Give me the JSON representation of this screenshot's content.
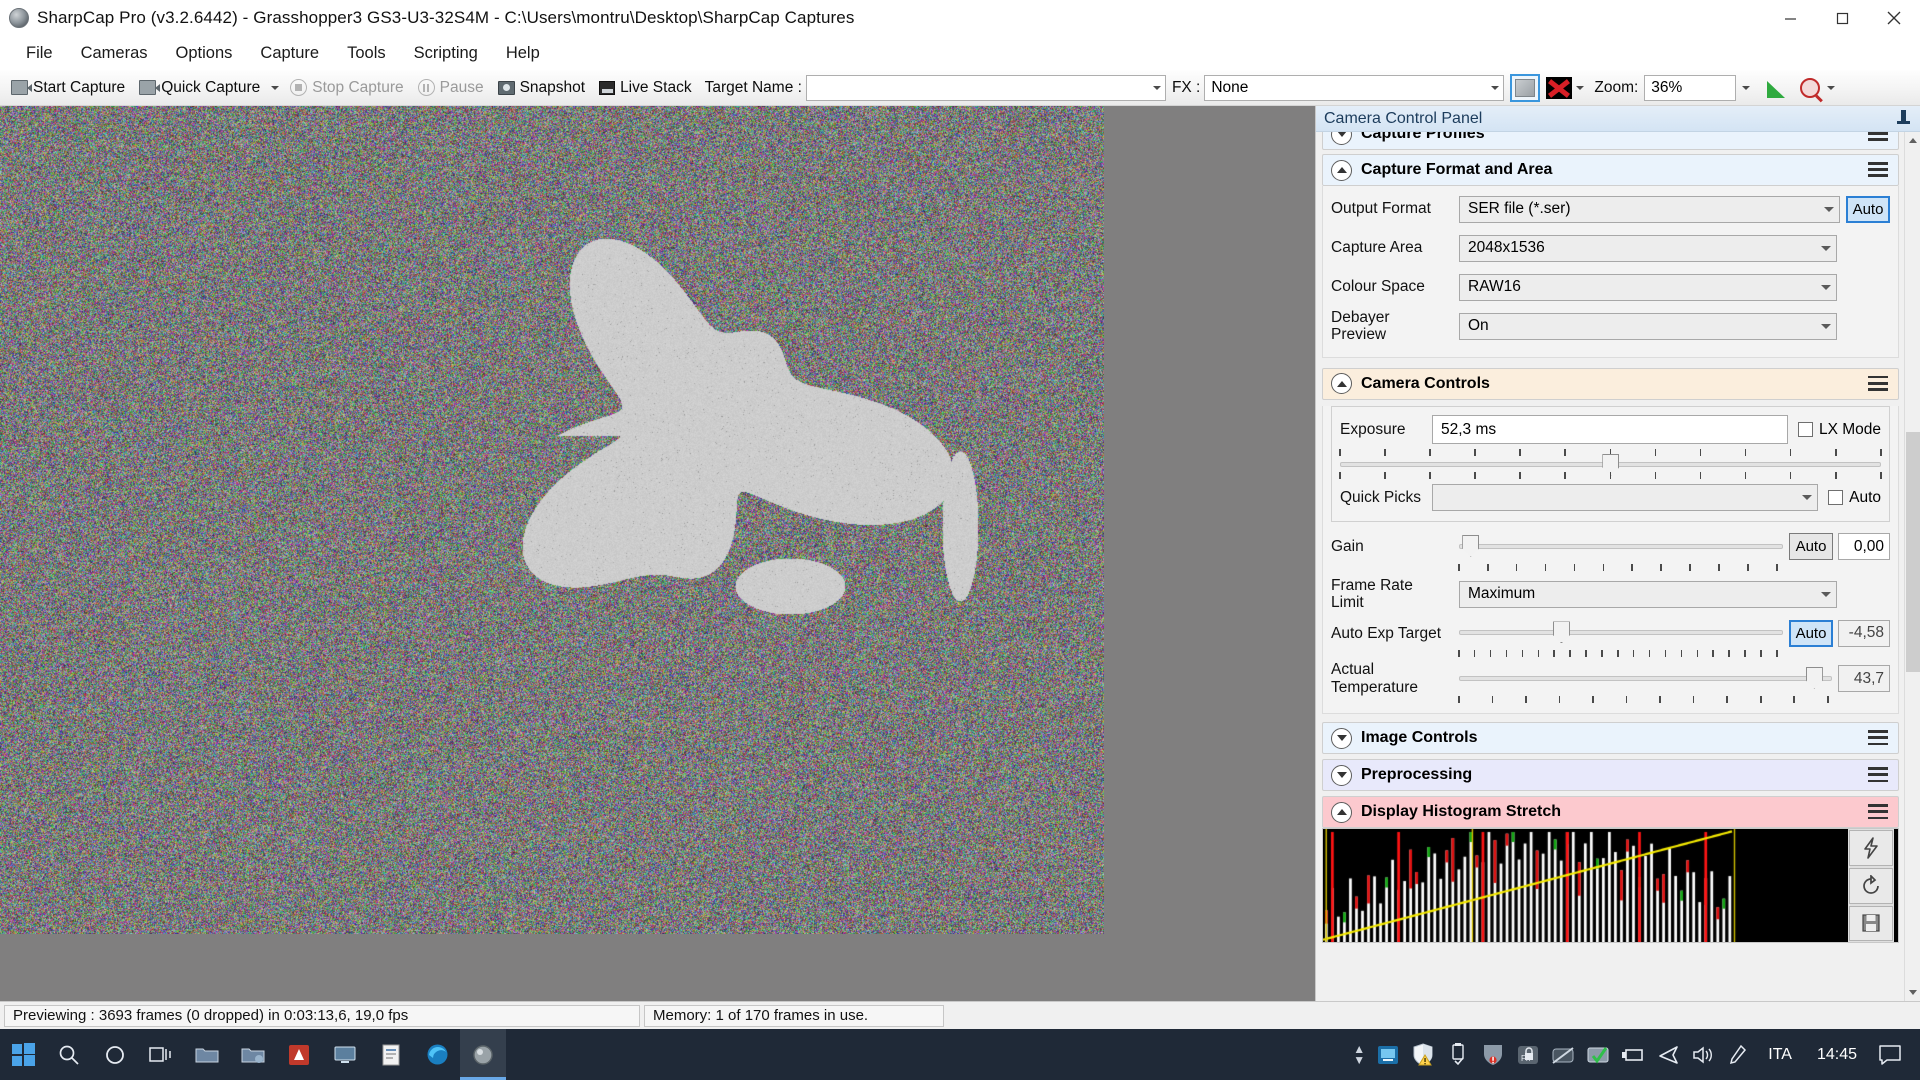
{
  "window": {
    "title": "SharpCap Pro (v3.2.6442) - Grasshopper3 GS3-U3-32S4M - C:\\Users\\montru\\Desktop\\SharpCap Captures",
    "icon": "sharpcap-logo-icon",
    "minimize": "minimize-icon",
    "maximize": "maximize-icon",
    "close": "close-icon"
  },
  "menubar": {
    "items": [
      {
        "label": "File"
      },
      {
        "label": "Cameras"
      },
      {
        "label": "Options"
      },
      {
        "label": "Capture"
      },
      {
        "label": "Tools"
      },
      {
        "label": "Scripting"
      },
      {
        "label": "Help"
      }
    ]
  },
  "toolbar": {
    "start_capture": "Start Capture",
    "quick_capture": "Quick Capture",
    "stop_capture": "Stop Capture",
    "pause": "Pause",
    "snapshot": "Snapshot",
    "live_stack": "Live Stack",
    "target_name_label": "Target Name :",
    "target_name_value": "",
    "fx_label": "FX :",
    "fx_value": "None",
    "zoom_label": "Zoom:",
    "zoom_value": "36%"
  },
  "panel": {
    "title": "Camera Control Panel",
    "groups": {
      "capture_profiles": {
        "label": "Capture Profiles",
        "expanded": false
      },
      "capture_format": {
        "label": "Capture Format and Area",
        "expanded": true,
        "rows": [
          {
            "label": "Output Format",
            "value": "SER file (*.ser)",
            "auto": "Auto"
          },
          {
            "label": "Capture Area",
            "value": "2048x1536"
          },
          {
            "label": "Colour Space",
            "value": "RAW16"
          },
          {
            "label": "Debayer Preview",
            "value": "On"
          }
        ]
      },
      "camera_controls": {
        "label": "Camera Controls",
        "expanded": true,
        "exposure": {
          "label": "Exposure",
          "value": "52,3 ms",
          "lx_mode_label": "LX Mode",
          "lx_mode_checked": false
        },
        "quick_picks": {
          "label": "Quick Picks",
          "value": "",
          "auto_label": "Auto",
          "auto_checked": false
        },
        "gain": {
          "label": "Gain",
          "value": "0,00",
          "auto_label": "Auto",
          "auto_active": false,
          "thumb_pct": 2
        },
        "frame_rate_limit": {
          "label": "Frame Rate Limit",
          "value": "Maximum"
        },
        "auto_exp_target": {
          "label": "Auto Exp Target",
          "value": "-4,58",
          "auto_label": "Auto",
          "auto_active": true,
          "thumb_pct": 30
        },
        "actual_temperature": {
          "label": "Actual Temperature",
          "value": "43,7",
          "thumb_pct": 94
        }
      },
      "image_controls": {
        "label": "Image Controls",
        "expanded": false
      },
      "preprocessing": {
        "label": "Preprocessing",
        "expanded": false
      },
      "display_histogram_stretch": {
        "label": "Display Histogram Stretch",
        "expanded": true,
        "buttons": [
          "lightning-icon",
          "reset-icon",
          "save-icon"
        ]
      }
    }
  },
  "statusbar": {
    "preview_text": "Previewing : 3693 frames (0 dropped) in 0:03:13,6, 19,0 fps",
    "memory_text": "Memory: 1 of 170 frames in use."
  },
  "taskbar": {
    "items": [
      {
        "name": "start-button",
        "icon": "windows-logo-icon"
      },
      {
        "name": "search-button",
        "icon": "search-icon"
      },
      {
        "name": "cortana-button",
        "icon": "circle-icon"
      },
      {
        "name": "task-view-button",
        "icon": "task-view-icon"
      },
      {
        "name": "app-folder",
        "icon": "folder-icon"
      },
      {
        "name": "app-folder-2",
        "icon": "folder-icon"
      },
      {
        "name": "app-filezilla",
        "icon": "filezilla-icon"
      },
      {
        "name": "app-remote-desktop",
        "icon": "monitor-icon"
      },
      {
        "name": "app-notes",
        "icon": "notes-icon"
      },
      {
        "name": "app-edge",
        "icon": "edge-icon"
      },
      {
        "name": "app-sharpcap",
        "icon": "sharpcap-icon",
        "active": true
      }
    ],
    "tray": [
      {
        "name": "tray-nvidia",
        "icon": "display-settings-icon"
      },
      {
        "name": "tray-security",
        "icon": "shield-warning-icon"
      },
      {
        "name": "tray-usb",
        "icon": "usb-icon"
      },
      {
        "name": "tray-firefox",
        "icon": "malwarebytes-icon"
      },
      {
        "name": "tray-fn-lock",
        "icon": "fn-lock-icon"
      },
      {
        "name": "tray-touchpad-off",
        "icon": "touchpad-off-icon"
      },
      {
        "name": "tray-update-ok",
        "icon": "update-ok-icon"
      },
      {
        "name": "tray-battery",
        "icon": "battery-icon"
      },
      {
        "name": "tray-airplane",
        "icon": "airplane-icon"
      },
      {
        "name": "tray-volume",
        "icon": "volume-icon"
      },
      {
        "name": "tray-pen",
        "icon": "pen-icon"
      }
    ],
    "language": "ITA",
    "clock": "14:45",
    "action_center": "notification-icon"
  },
  "colors": {
    "accent_blue": "#2b7fd4",
    "pink_header": "#fcc9ce",
    "cream_header": "#fbeedd",
    "blue_header": "#eaf3fc",
    "lavender_header": "#e8e9fb",
    "taskbar": "#1f2937",
    "preview_bg": "#807f7f"
  }
}
